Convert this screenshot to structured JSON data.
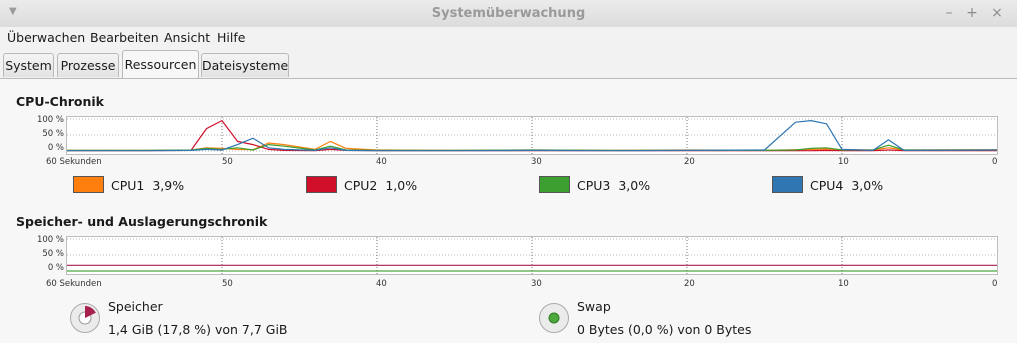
{
  "window": {
    "title": "Systemüberwachung"
  },
  "menu": [
    "Überwachen",
    "Bearbeiten",
    "Ansicht",
    "Hilfe"
  ],
  "tabs": [
    "System",
    "Prozesse",
    "Ressourcen",
    "Dateisysteme"
  ],
  "active_tab": "Ressourcen",
  "cpu": {
    "heading": "CPU-Chronik",
    "y_labels": [
      "100 %",
      "50 %",
      "0 %"
    ],
    "x_labels": [
      "60 Sekunden",
      "50",
      "40",
      "30",
      "20",
      "10",
      "0"
    ],
    "legend": [
      {
        "name": "CPU1",
        "value": "3,9%",
        "color": "#ff7f0e"
      },
      {
        "name": "CPU2",
        "value": "1,0%",
        "color": "#d00f2b"
      },
      {
        "name": "CPU3",
        "value": "3,0%",
        "color": "#3c9f2f"
      },
      {
        "name": "CPU4",
        "value": "3,0%",
        "color": "#2f76b2"
      }
    ]
  },
  "memory": {
    "heading": "Speicher- und Auslagerungschronik",
    "y_labels": [
      "100 %",
      "50 %",
      "0 %"
    ],
    "x_labels": [
      "60 Sekunden",
      "50",
      "40",
      "30",
      "20",
      "10",
      "0"
    ],
    "speicher": {
      "label": "Speicher",
      "value": "1,4 GiB (17,8 %) von 7,7 GiB",
      "color": "#a8204e"
    },
    "swap": {
      "label": "Swap",
      "value": "0 Bytes (0,0 %) von 0 Bytes",
      "color": "#4ca83c"
    }
  },
  "chart_data": [
    {
      "type": "line",
      "title": "CPU-Chronik",
      "x": [
        60,
        55,
        52,
        51,
        50,
        49,
        48,
        47,
        46,
        44,
        43,
        42,
        40,
        35,
        30,
        25,
        20,
        15,
        13,
        12,
        11,
        10,
        8,
        7,
        6,
        0
      ],
      "xlim": [
        60,
        0
      ],
      "ylim": [
        0,
        100
      ],
      "series": [
        {
          "name": "CPU1",
          "values": [
            2,
            2,
            3,
            10,
            8,
            5,
            4,
            25,
            20,
            5,
            30,
            8,
            3,
            2,
            3,
            2,
            3,
            2,
            4,
            5,
            6,
            4,
            3,
            10,
            3,
            4
          ]
        },
        {
          "name": "CPU2",
          "values": [
            1,
            1,
            2,
            70,
            95,
            30,
            20,
            5,
            2,
            1,
            5,
            2,
            1,
            1,
            1,
            1,
            1,
            1,
            1,
            1,
            2,
            1,
            1,
            3,
            1,
            1
          ]
        },
        {
          "name": "CPU3",
          "values": [
            2,
            2,
            3,
            8,
            5,
            10,
            3,
            20,
            15,
            3,
            15,
            3,
            2,
            2,
            3,
            2,
            2,
            2,
            3,
            8,
            10,
            3,
            3,
            18,
            3,
            3
          ]
        },
        {
          "name": "CPU4",
          "values": [
            1,
            1,
            2,
            5,
            3,
            20,
            40,
            10,
            5,
            2,
            10,
            2,
            1,
            1,
            2,
            1,
            2,
            3,
            90,
            95,
            85,
            5,
            2,
            35,
            2,
            3
          ]
        }
      ]
    },
    {
      "type": "line",
      "title": "Speicher- und Auslagerungschronik",
      "x": [
        60,
        0
      ],
      "xlim": [
        60,
        0
      ],
      "ylim": [
        0,
        100
      ],
      "series": [
        {
          "name": "Speicher",
          "values": [
            17.8,
            17.8
          ]
        },
        {
          "name": "Swap",
          "values": [
            0,
            0
          ]
        }
      ]
    }
  ]
}
